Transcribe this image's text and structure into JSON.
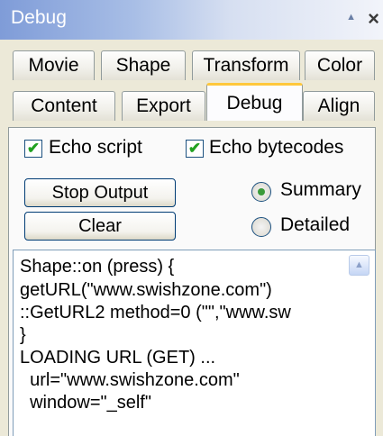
{
  "window": {
    "title": "Debug",
    "collapse_glyph": "▲",
    "close_glyph": "×"
  },
  "tabs": {
    "row1": [
      "Movie",
      "Shape",
      "Transform",
      "Color"
    ],
    "row2": [
      "Content",
      "Export",
      "Debug",
      "Align"
    ],
    "active": "Debug"
  },
  "options": {
    "echo_script": {
      "label": "Echo script",
      "checked": true
    },
    "echo_bytecodes": {
      "label": "Echo bytecodes",
      "checked": true
    }
  },
  "buttons": {
    "stop_output": "Stop Output",
    "clear": "Clear"
  },
  "radios": {
    "summary": {
      "label": "Summary",
      "selected": true
    },
    "detailed": {
      "label": "Detailed",
      "selected": false
    }
  },
  "output": {
    "lines": [
      "Shape::on (press) {",
      "getURL(\"www.swishzone.com\")",
      "::GetURL2 method=0 (\"\",\"www.sw",
      "}",
      "LOADING URL (GET) ...",
      "  url=\"www.swishzone.com\"",
      "  window=\"_self\""
    ]
  },
  "icons": {
    "check": "✔",
    "scroll_up": "▲"
  },
  "colors": {
    "active_tab_accent": "#FFC83C",
    "title_gradient_start": "#7F9CD8",
    "check_green": "#21A121"
  }
}
